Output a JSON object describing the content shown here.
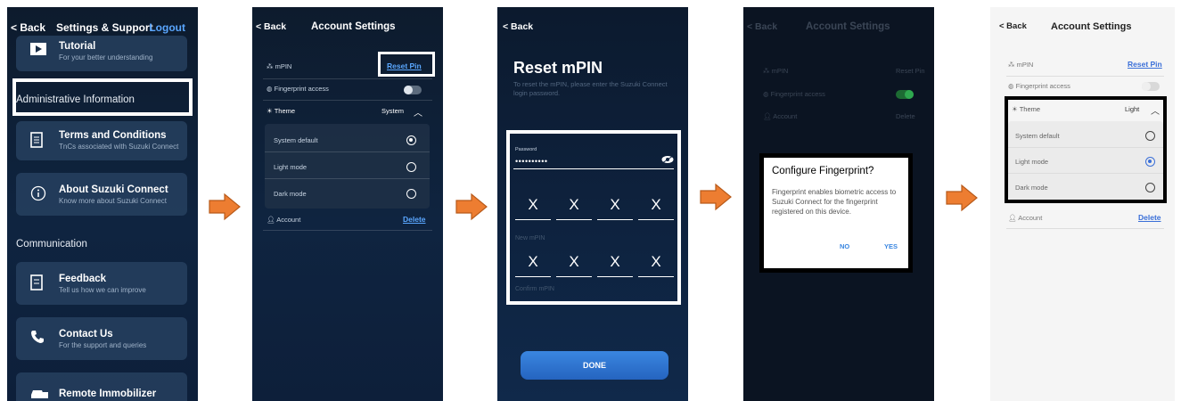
{
  "screen1": {
    "back": "< Back",
    "title": "Settings & Support",
    "logout": "Logout",
    "tutorial": {
      "title": "Tutorial",
      "sub": "For your better understanding"
    },
    "admin_header": "Administrative Information",
    "terms": {
      "title": "Terms and Conditions",
      "sub": "TnCs associated with Suzuki Connect"
    },
    "about": {
      "title": "About Suzuki Connect",
      "sub": "Know more about Suzuki Connect"
    },
    "communication": "Communication",
    "feedback": {
      "title": "Feedback",
      "sub": "Tell us how we can improve"
    },
    "contact": {
      "title": "Contact Us",
      "sub": "For the support and queries"
    },
    "remote": {
      "title": "Remote Immobilizer"
    }
  },
  "screen2": {
    "back": "< Back",
    "title": "Account Settings",
    "mpin": "mPIN",
    "reset_pin": "Reset Pin",
    "fingerprint": "Fingerprint access",
    "theme": "Theme",
    "theme_value": "System",
    "options": [
      "System default",
      "Light mode",
      "Dark mode"
    ],
    "account": "Account",
    "delete": "Delete"
  },
  "screen3": {
    "back": "< Back",
    "title": "Reset mPIN",
    "desc": "To reset the mPIN, please enter the Suzuki Connect login password.",
    "password_label": "Password",
    "password_value": "••••••••••",
    "x": "X",
    "new_label": "New mPIN",
    "confirm_label": "Confirm mPIN",
    "done": "DONE"
  },
  "screen4": {
    "back": "< Back",
    "title": "Account Settings",
    "mpin": "mPIN",
    "reset_pin": "Reset Pin",
    "fingerprint": "Fingerprint access",
    "account": "Account",
    "delete": "Delete",
    "dialog_title": "Configure Fingerprint?",
    "dialog_body": "Fingerprint enables biometric access to Suzuki Connect for the fingerprint registered on this device.",
    "no": "NO",
    "yes": "YES"
  },
  "screen5": {
    "back": "< Back",
    "title": "Account Settings",
    "mpin": "mPIN",
    "reset_pin": "Reset Pin",
    "fingerprint": "Fingerprint access",
    "theme": "Theme",
    "theme_value": "Light",
    "options": [
      "System default",
      "Light mode",
      "Dark mode"
    ],
    "account": "Account",
    "delete": "Delete"
  },
  "colors": {
    "accent": "#5aa7ff",
    "arrow": "#ed7d31",
    "toggle_on": "#2fa84f",
    "done": "#2f74d0"
  }
}
